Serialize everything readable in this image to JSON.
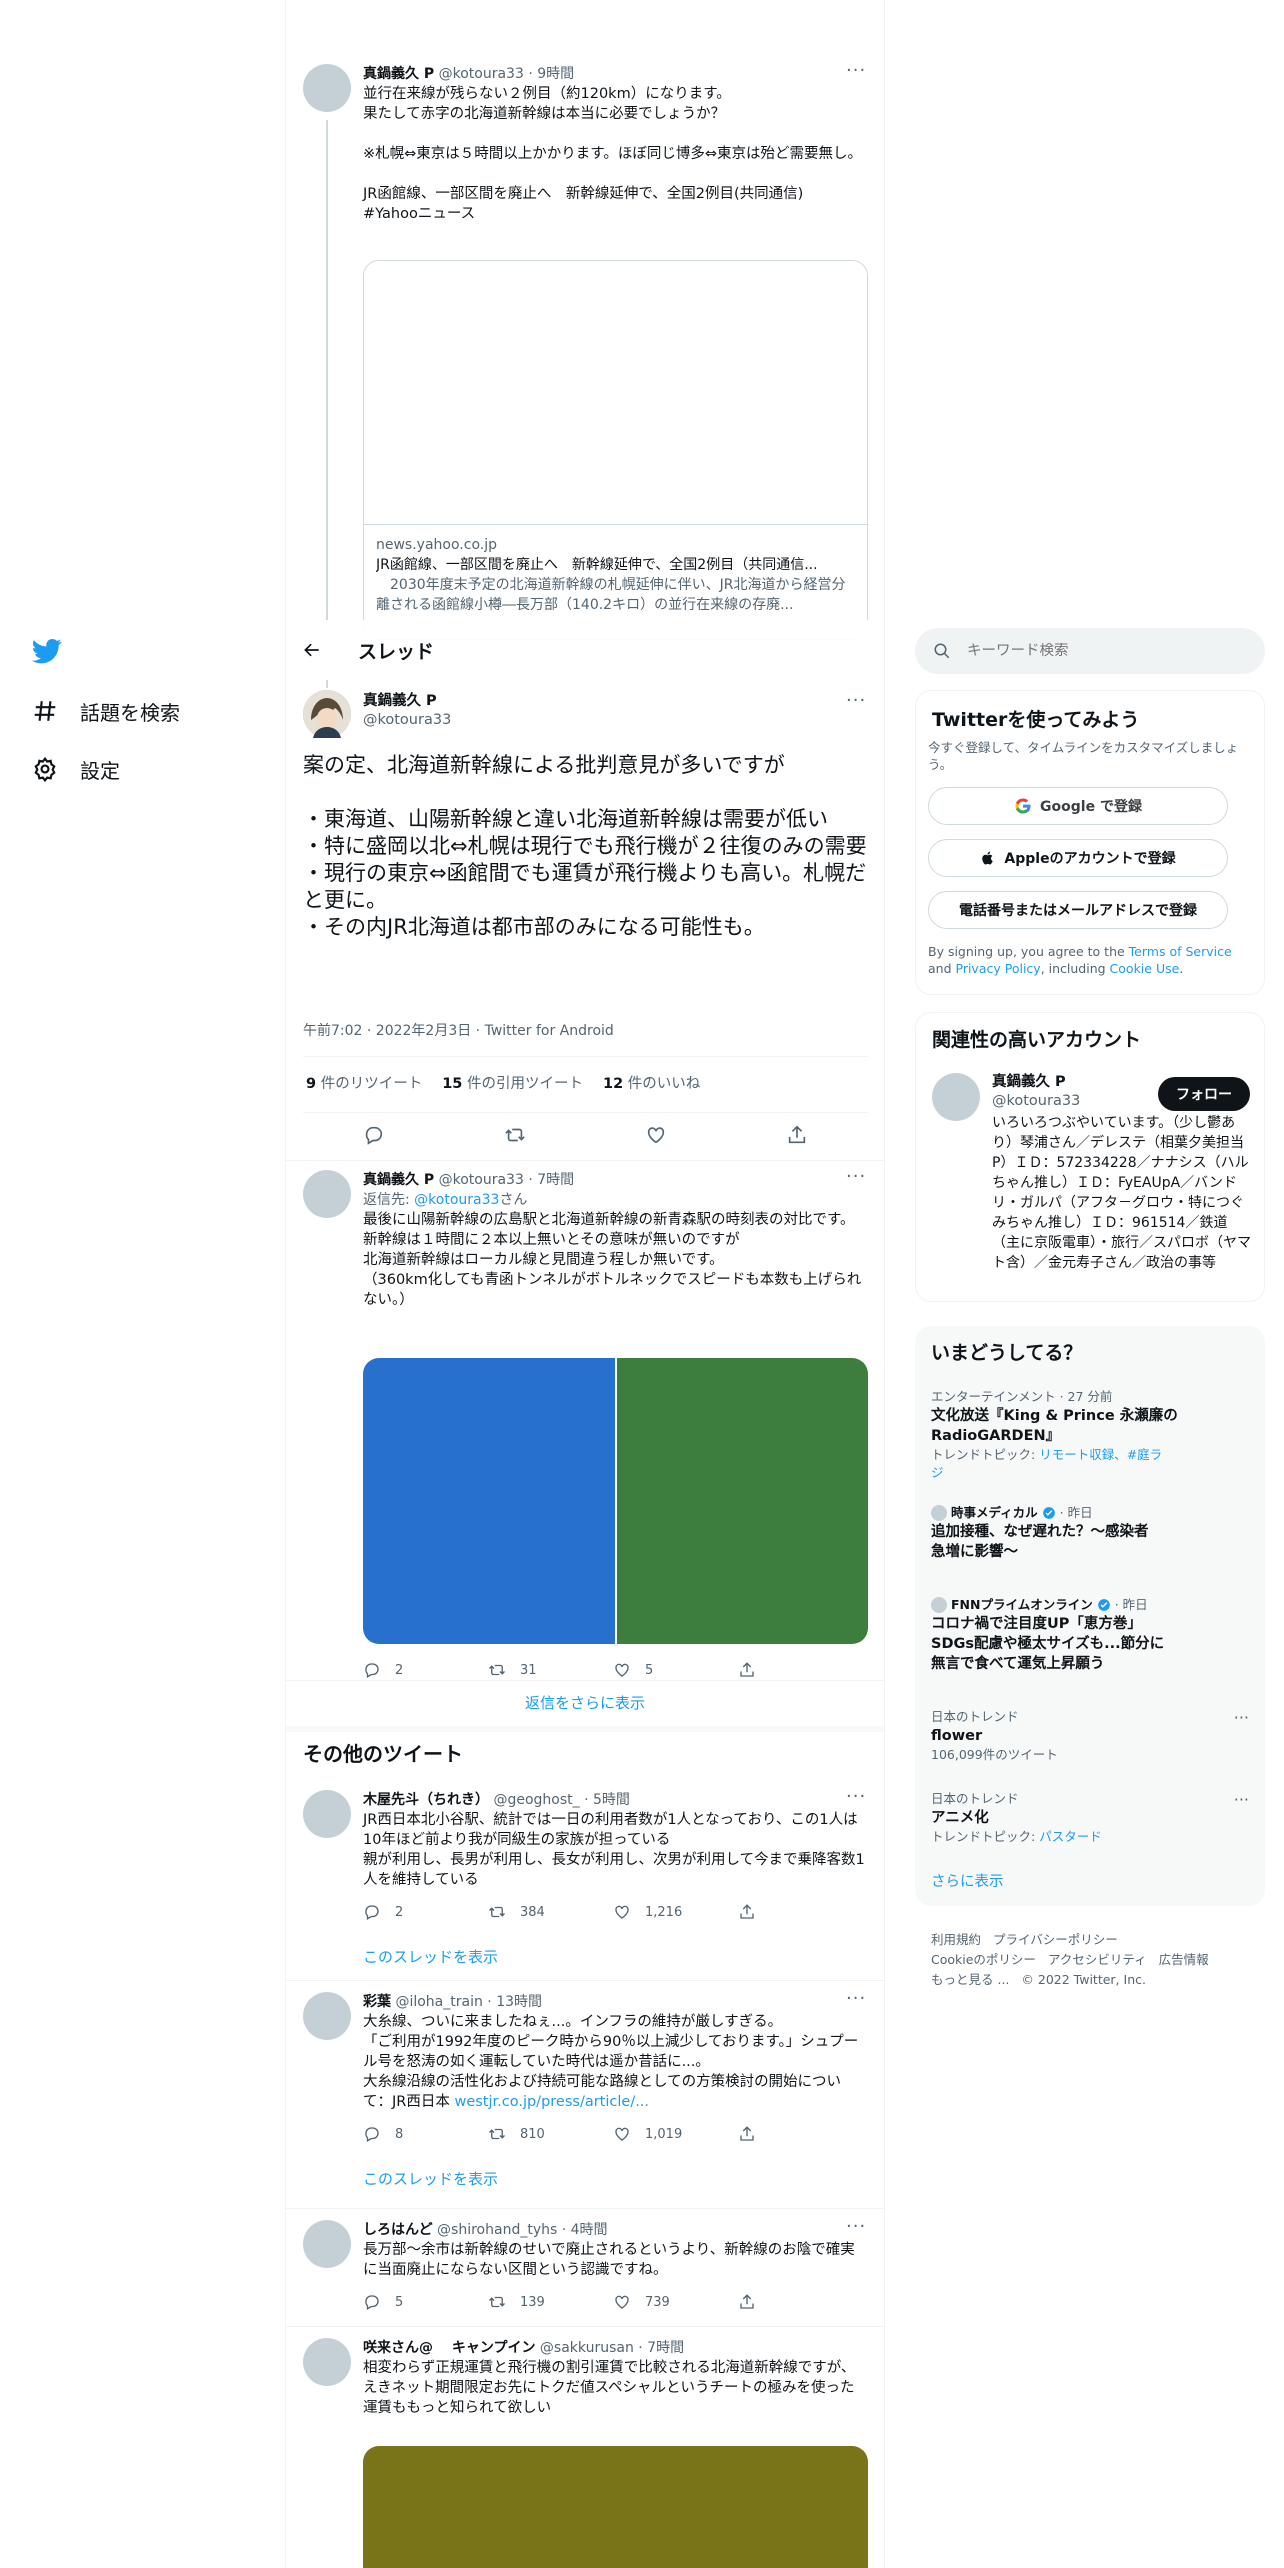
{
  "nav": {
    "explore_label": "話題を検索",
    "settings_label": "設定"
  },
  "top_tweet": {
    "name": "真鍋義久 P",
    "handle": "@kotoura33",
    "time": "· 9時間",
    "text": "並行在来線が残らない２例目（約120km）になります。\n果たして赤字の北海道新幹線は本当に必要でしょうか？\n\n※札幌⇔東京は５時間以上かかります。ほぼ同じ博多⇔東京は殆ど需要無し。\n\nJR函館線、一部区間を廃止へ　新幹線延伸で、全国2例目(共同通信)",
    "hashtag": "#Yahooニュース",
    "card": {
      "domain": "news.yahoo.co.jp",
      "title": "JR函館線、一部区間を廃止へ　新幹線延伸で、全国2例目（共同通信...",
      "desc": "　2030年度末予定の北海道新幹線の札幌延伸に伴い、JR北海道から経営分離される函館線小樽―長万部（140.2キロ）の並行在来線の存廃..."
    }
  },
  "thread_header": {
    "title": "スレッド"
  },
  "main_tweet": {
    "name": "真鍋義久 P",
    "handle": "@kotoura33",
    "text": "案の定、北海道新幹線による批判意見が多いですが\n\n・東海道、山陽新幹線と違い北海道新幹線は需要が低い\n・特に盛岡以北⇔札幌は現行でも飛行機が２往復のみの需要\n・現行の東京⇔函館間でも運賃が飛行機よりも高い。札幌だと更に。\n・その内JR北海道は都市部のみになる可能性も。",
    "meta": "午前7:02 · 2022年2月3日 · Twitter for Android",
    "retweets": "9",
    "retweets_label": " 件のリツイート",
    "quotes": "15",
    "quotes_label": " 件の引用ツイート",
    "likes": "12",
    "likes_label": " 件のいいね"
  },
  "reply_tweet": {
    "name": "真鍋義久 P",
    "handle": "@kotoura33",
    "time": "· 7時間",
    "reply_prefix": "返信先: ",
    "reply_to": "@kotoura33",
    "reply_suffix": "さん",
    "text": "最後に山陽新幹線の広島駅と北海道新幹線の新青森駅の時刻表の対比です。\n新幹線は１時間に２本以上無いとその意味が無いのですが\n北海道新幹線はローカル線と見間違う程しか無いです。\n（360km化しても青函トンネルがボトルネックでスピードも本数も上げられない。）",
    "replies": "2",
    "retweets": "31",
    "likes": "5",
    "img_colors": [
      "#2770cc",
      "#3d7d3d"
    ]
  },
  "show_more_replies": "返信をさらに表示",
  "other_tweets_heading": "その他のツイート",
  "other_tweets": [
    {
      "name": "木屋先斗（ちれき）",
      "handle": "@geoghost_",
      "time": "· 5時間",
      "text": "JR西日本北小谷駅、統計では一日の利用者数が1人となっており、この1人は10年ほど前より我が同級生の家族が担っている\n親が利用し、長男が利用し、長女が利用し、次男が利用して今まで乗降客数1人を維持している",
      "replies": "2",
      "retweets": "384",
      "likes": "1,216",
      "show_thread": "このスレッドを表示"
    },
    {
      "name": "彩葉",
      "handle": "@iloha_train",
      "time": "· 13時間",
      "text": "大糸線、ついに来ましたねぇ...。インフラの維持が厳しすぎる。\n「ご利用が1992年度のピーク時から90％以上減少しております。」シュプール号を怒涛の如く運転していた時代は遥か昔話に...。\n大糸線沿線の活性化および持続可能な路線としての方策検討の開始について：JR西日本 ",
      "link": "westjr.co.jp/press/article/...",
      "replies": "8",
      "retweets": "810",
      "likes": "1,019",
      "show_thread": "このスレッドを表示"
    },
    {
      "name": "しろはんど",
      "handle": "@shirohand_tyhs",
      "time": "· 4時間",
      "text": "長万部〜余市は新幹線のせいで廃止されるというより、新幹線のお陰で確実に当面廃止にならない区間という認識ですね。",
      "replies": "5",
      "retweets": "139",
      "likes": "739"
    },
    {
      "name": "咲来さん@　 キャンプイン",
      "handle": "@sakkurusan",
      "time": "· 7時間",
      "text": "相変わらず正規運賃と飛行機の割引運賃で比較される北海道新幹線ですが、えきネット期間限定お先にトクだ値スペシャルというチートの極みを使った運賃ももっと知られて欲しい",
      "img_color": "#7a7418"
    }
  ],
  "search": {
    "placeholder": "キーワード検索"
  },
  "signup": {
    "title": "Twitterを使ってみよう",
    "subtitle": "今すぐ登録して、タイムラインをカスタマイズしましょう。",
    "google_label": "Google で登録",
    "apple_label": "Appleのアカウントで登録",
    "phone_label": "電話番号またはメールアドレスで登録",
    "legal_1": "By signing up, you agree to the ",
    "terms": "Terms of Service",
    "legal_2": " and ",
    "privacy": "Privacy Policy",
    "legal_3": ", including ",
    "cookie": "Cookie Use",
    "legal_4": "."
  },
  "related": {
    "title": "関連性の高いアカウント",
    "name": "真鍋義久 P",
    "handle": "@kotoura33",
    "follow_label": "フォロー",
    "bio": "いろいろつぶやいています。（少し鬱あり）琴浦さん／デレステ（相葉夕美担当P）ＩＤ：572334228／ナナシス（ハルちゃん推し）ＩＤ：FyEAUpA／バンドリ・ガルパ（アフタ－グロウ・特につぐみちゃん推し）ＩＤ：961514／鉄道（主に京阪電車）・旅行／スパロボ（ヤマト含）／金元寿子さん／政治の事等"
  },
  "trends": {
    "title": "いまどうしてる？",
    "items": [
      {
        "context": "エンターテインメント · 27 分前",
        "headline": "文化放送『King & Prince 永瀬廉のRadioGARDEN』",
        "topic_prefix": "トレンドトピック: ",
        "topic": "リモート収録、#庭ラジ"
      },
      {
        "source": "時事メディカル",
        "time": "· 昨日",
        "headline": "追加接種、なぜ遅れた？～感染者急増に影響～"
      },
      {
        "source": "FNNプライムオンライン",
        "time": "· 昨日",
        "headline": "コロナ禍で注目度UP「恵方巻」SDGs配慮や極太サイズも...節分に無言で食べて運気上昇願う"
      },
      {
        "context": "日本のトレンド",
        "headline": "flower",
        "count": "106,099件のツイート"
      },
      {
        "context": "日本のトレンド",
        "headline": "アニメ化",
        "topic_prefix": "トレンドトピック: ",
        "topic": "パスタード"
      }
    ],
    "show_more": "さらに表示"
  },
  "footer": {
    "terms": "利用規約",
    "privacy": "プライバシーポリシー",
    "cookie": "Cookieのポリシー",
    "accessibility": "アクセシビリティ",
    "ads": "広告情報",
    "more": "もっと見る ...",
    "copyright": "© 2022 Twitter, Inc."
  }
}
